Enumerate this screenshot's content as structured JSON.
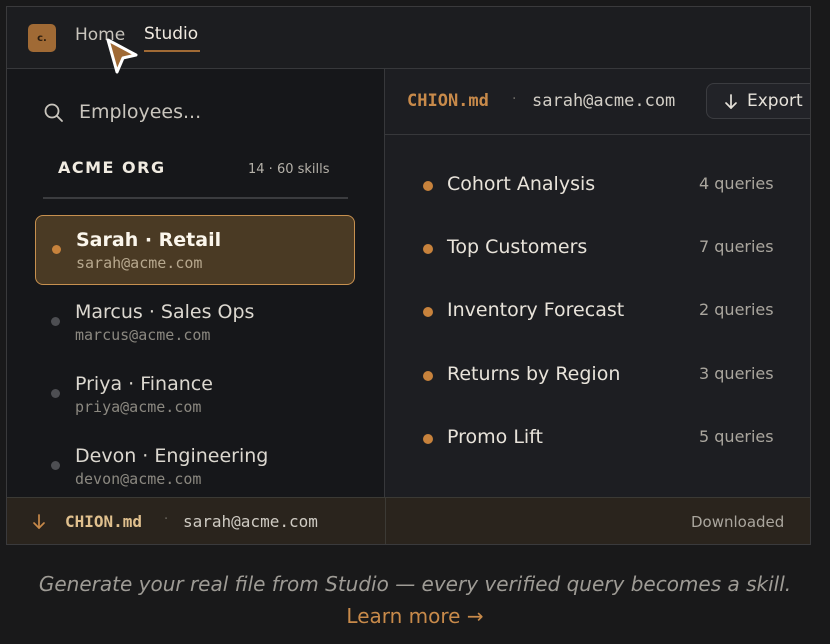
{
  "nav": {
    "logo_text": "c.",
    "home": "Home",
    "studio": "Studio",
    "active": "Studio"
  },
  "search": {
    "placeholder": "Employees..."
  },
  "org": {
    "name": "ACME ORG",
    "meta": "14 · 60 skills"
  },
  "employees": [
    {
      "name": "Sarah · Retail",
      "email": "sarah@acme.com",
      "selected": true
    },
    {
      "name": "Marcus · Sales Ops",
      "email": "marcus@acme.com",
      "selected": false
    },
    {
      "name": "Priya · Finance",
      "email": "priya@acme.com",
      "selected": false
    },
    {
      "name": "Devon · Engineering",
      "email": "devon@acme.com",
      "selected": false
    }
  ],
  "detail": {
    "file": "CHION.md",
    "separator": "·",
    "email": "sarah@acme.com",
    "export_label": "Export",
    "queries": [
      {
        "name": "Cohort Analysis",
        "count": "4 queries"
      },
      {
        "name": "Top Customers",
        "count": "7 queries"
      },
      {
        "name": "Inventory Forecast",
        "count": "2 queries"
      },
      {
        "name": "Returns by Region",
        "count": "3 queries"
      },
      {
        "name": "Promo Lift",
        "count": "5 queries"
      }
    ]
  },
  "download_bar": {
    "file": "CHION.md",
    "separator": "·",
    "email": "sarah@acme.com",
    "status": "Downloaded"
  },
  "caption": {
    "text": "Generate your real file from Studio — every verified query becomes a skill.",
    "link": "Learn more →"
  },
  "colors": {
    "accent": "#c88a4a",
    "selected_bg": "#4a3a24",
    "background": "#19191a"
  },
  "icons": {
    "search": "search-icon",
    "export": "download-arrow-icon",
    "cursor": "cursor-pointer-icon"
  }
}
